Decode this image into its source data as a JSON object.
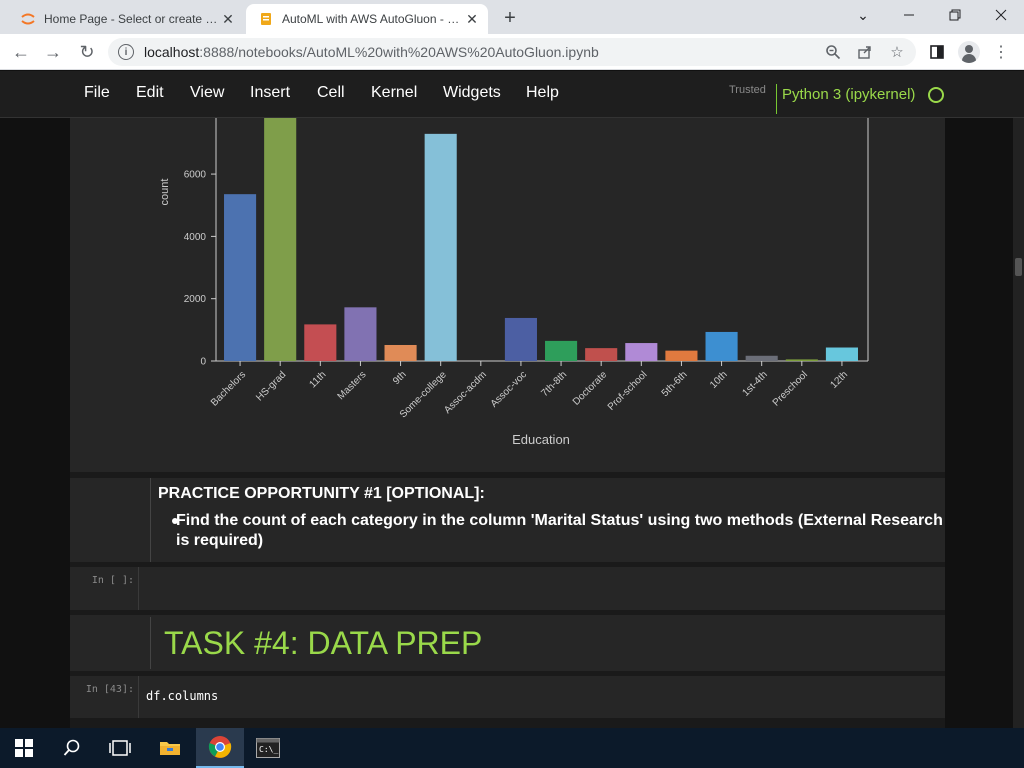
{
  "browser": {
    "tabs": [
      {
        "title": "Home Page - Select or create a notebook",
        "active": false
      },
      {
        "title": "AutoML with AWS AutoGluon - Jupyter Notebook",
        "active": true
      }
    ],
    "url_host": "localhost",
    "url_path": ":8888/notebooks/AutoML%20with%20AWS%20AutoGluon.ipynb"
  },
  "jupyter": {
    "menu": [
      "File",
      "Edit",
      "View",
      "Insert",
      "Cell",
      "Kernel",
      "Widgets",
      "Help"
    ],
    "trusted": "Trusted",
    "kernel": "Python 3 (ipykernel)"
  },
  "chart_data": {
    "type": "bar",
    "xlabel": "Education",
    "ylabel": "count",
    "ylim": [
      0,
      7800
    ],
    "yticks": [
      0,
      2000,
      4000,
      6000
    ],
    "categories": [
      "Bachelors",
      "HS-grad",
      "11th",
      "Masters",
      "9th",
      "Some-college",
      "Assoc-acdm",
      "Assoc-voc",
      "7th-8th",
      "Doctorate",
      "Prof-school",
      "5th-6th",
      "10th",
      "1st-4th",
      "Preschool",
      "12th"
    ],
    "values": [
      5355,
      7800,
      1175,
      1723,
      514,
      7291,
      0,
      1382,
      646,
      413,
      576,
      333,
      933,
      168,
      51,
      433
    ],
    "colors": [
      "#4c72b0",
      "#7f9e4a",
      "#c44e52",
      "#8172b2",
      "#e08b57",
      "#85c0d8",
      "#4c72b0",
      "#4c5fa3",
      "#2e9e5b",
      "#c0504d",
      "#b08ad6",
      "#e07a3f",
      "#3d8fd1",
      "#6b6e78",
      "#7fa03e",
      "#67c7dd"
    ],
    "legend": "none",
    "grid": false
  },
  "cells": {
    "md_heading": "PRACTICE OPPORTUNITY #1 [OPTIONAL]:",
    "md_item": "Find the count of each category in the column 'Marital Status' using two methods (External Research is required)",
    "empty_prompt": "In [ ]:",
    "task_title": "TASK #4: DATA PREP",
    "code_prompt": "In [43]:",
    "code": "df.columns"
  }
}
